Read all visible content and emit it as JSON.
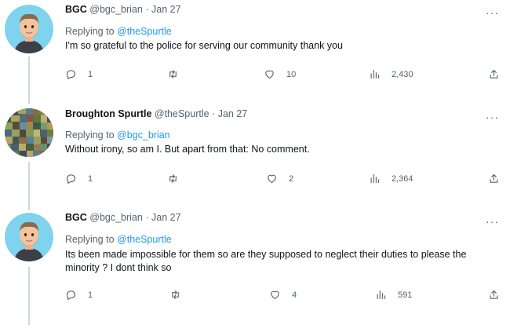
{
  "tweets": [
    {
      "name": "BGC",
      "handle": "@bgc_brian",
      "sep": "·",
      "date": "Jan 27",
      "replying_prefix": "Replying to",
      "replying_to": "@theSpurtle",
      "text": "I'm so grateful to the police for serving our community thank you",
      "replies": "1",
      "retweets": "",
      "likes": "10",
      "views": "2,430",
      "avatar": "memoji"
    },
    {
      "name": "Broughton Spurtle",
      "handle": "@theSpurtle",
      "sep": "·",
      "date": "Jan 27",
      "replying_prefix": "Replying to",
      "replying_to": "@bgc_brian",
      "text": "Without irony, so am I. But apart from that: No comment.",
      "replies": "1",
      "retweets": "",
      "likes": "2",
      "views": "2,364",
      "avatar": "mosaic"
    },
    {
      "name": "BGC",
      "handle": "@bgc_brian",
      "sep": "·",
      "date": "Jan 27",
      "replying_prefix": "Replying to",
      "replying_to": "@theSpurtle",
      "text": "Its been made impossible for them so are they supposed to neglect their duties to please the minority ? I dont think so",
      "replies": "1",
      "retweets": "",
      "likes": "4",
      "views": "591",
      "avatar": "memoji"
    }
  ],
  "icons": {
    "reply": "reply-icon",
    "retweet": "retweet-icon",
    "like": "heart-icon",
    "views": "views-icon",
    "share": "share-icon",
    "more": "more-icon"
  },
  "colors": {
    "link": "#1d9bf0",
    "secondary": "#536471",
    "thread_line": "#cfd9de"
  },
  "more_glyph": "···"
}
